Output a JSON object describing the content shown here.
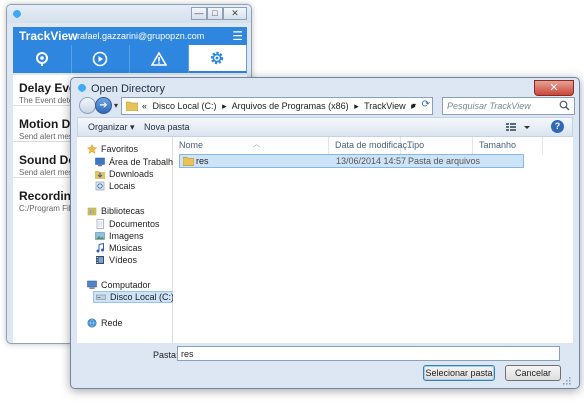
{
  "trackview": {
    "logo": "TrackView",
    "email": "rafael.gazzarini@grupopzn.com",
    "window_controls": {
      "minimize": "—",
      "maximize": "□",
      "close": "✕"
    },
    "tabs": [
      {
        "name": "location-tab",
        "icon": "location-pin-icon"
      },
      {
        "name": "play-tab",
        "icon": "play-icon"
      },
      {
        "name": "alert-tab",
        "icon": "warning-icon"
      },
      {
        "name": "settings-tab",
        "icon": "gear-icon",
        "active": true
      }
    ],
    "items": [
      {
        "title": "Delay Event",
        "subtitle": "The Event detecti"
      },
      {
        "title": "Motion Dete",
        "subtitle": "Send alert message"
      },
      {
        "title": "Sound Detec",
        "subtitle": "Send alert message"
      },
      {
        "title": "Recording F",
        "subtitle": "C:/Program Files (x"
      }
    ]
  },
  "dialog": {
    "title": "Open Directory",
    "close": "✕",
    "breadcrumb": [
      "«",
      "Disco Local (C:)",
      "▸",
      "Arquivos de Programas (x86)",
      "▸",
      "TrackView",
      "▸"
    ],
    "search_placeholder": "Pesquisar TrackView",
    "toolbar": {
      "organize": "Organizar ▾",
      "new_folder": "Nova pasta",
      "help": "?"
    },
    "sidebar": {
      "favorites_header": "Favoritos",
      "favorites": [
        "Área de Trabalho",
        "Downloads",
        "Locais"
      ],
      "libraries_header": "Bibliotecas",
      "libraries": [
        "Documentos",
        "Imagens",
        "Músicas",
        "Vídeos"
      ],
      "computer_header": "Computador",
      "computer": [
        "Disco Local (C:)"
      ],
      "network_header": "Rede"
    },
    "columns": [
      "Nome",
      "Data de modificaç...",
      "Tipo",
      "Tamanho"
    ],
    "rows": [
      {
        "name": "res",
        "date": "13/06/2014 14:57",
        "type": "Pasta de arquivos",
        "size": ""
      }
    ],
    "folder_label": "Pasta:",
    "folder_value": "res",
    "select_button": "Selecionar pasta",
    "cancel_button": "Cancelar"
  },
  "colors": {
    "trackview_blue": "#2e86de",
    "selection": "#cde3f7",
    "dialog_frame": "#dce7f3"
  }
}
